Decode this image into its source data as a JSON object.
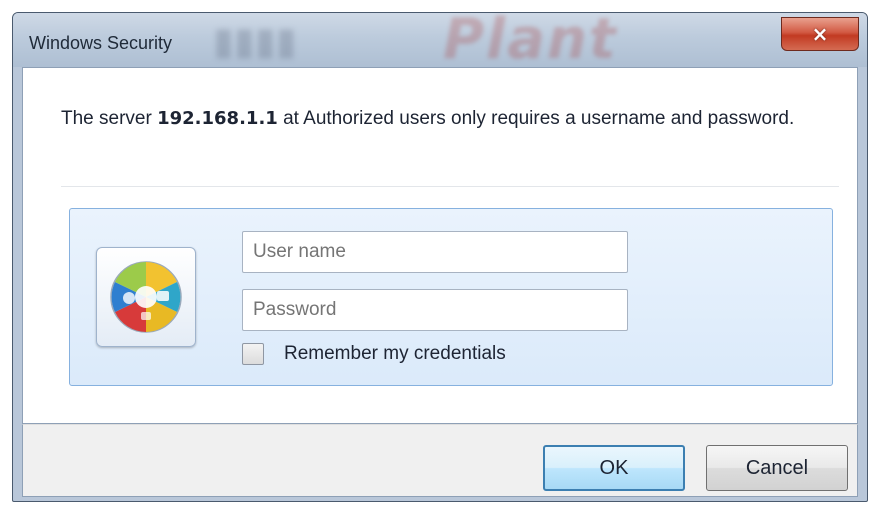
{
  "window": {
    "title": "Windows Security",
    "close_label": "×",
    "background_text": "Plant"
  },
  "message": {
    "prefix": "The server ",
    "server": "192.168.1.1",
    "suffix": " at Authorized users only requires a username and password."
  },
  "credentials": {
    "username_placeholder": "User name",
    "password_placeholder": "Password",
    "remember_label": "Remember my credentials",
    "remember_checked": false
  },
  "buttons": {
    "ok": "OK",
    "cancel": "Cancel"
  },
  "icons": {
    "credential_tile": "credential-icon",
    "close": "close-icon"
  },
  "colors": {
    "close_button": "#c23a22",
    "panel": "#dbeafa",
    "ok_border": "#3c7fb1"
  }
}
